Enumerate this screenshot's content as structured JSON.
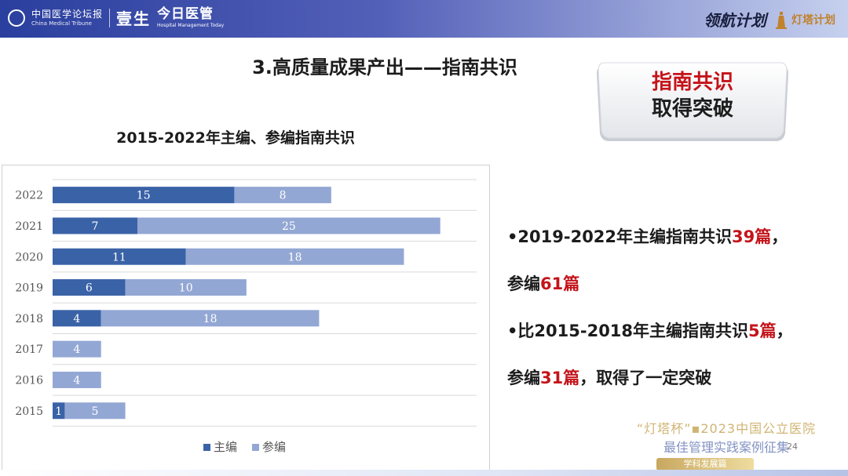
{
  "header": {
    "logo1_cn": "中国医学论坛报",
    "logo1_en": "China Medical Tribune",
    "logo2": "壹生",
    "logo3_cn": "今日医管",
    "logo3_en": "Hospital Management Today",
    "right_script": "领航计划",
    "right_lamp": "灯塔计划"
  },
  "title": "3.高质量成果产出——指南共识",
  "badge": {
    "line1": "指南共识",
    "line2": "取得突破"
  },
  "bullets": [
    {
      "p1": "•2019-2022年主编指南共识",
      "n1": "39篇",
      "p2": "，"
    },
    {
      "p1": "参编",
      "n1": "61篇",
      "p2": ""
    },
    {
      "p1": "•比2015-2018年主编指南共识",
      "n1": "5篇",
      "p2": "，"
    },
    {
      "p1": "参编",
      "n1": "31篇",
      "p2": "，取得了一定突破"
    }
  ],
  "footer": {
    "line1": "“灯塔杯”▪2023中国公立医院",
    "line2": "最佳管理实践案例征集",
    "chip": "学科发展篇",
    "page": "24"
  },
  "colors": {
    "zhubian": "#3a62a7",
    "canbian": "#93a7d4",
    "accent_red": "#c4141a"
  },
  "chart_data": {
    "type": "bar",
    "orientation": "horizontal",
    "stacked": true,
    "title": "2015-2022年主编、参编指南共识",
    "categories": [
      "2022",
      "2021",
      "2020",
      "2019",
      "2018",
      "2017",
      "2016",
      "2015"
    ],
    "series": [
      {
        "name": "主编",
        "values": [
          15,
          7,
          11,
          6,
          4,
          0,
          0,
          1
        ]
      },
      {
        "name": "参编",
        "values": [
          8,
          25,
          18,
          10,
          18,
          4,
          4,
          5
        ]
      }
    ],
    "xlim": [
      0,
      35
    ],
    "grid": true,
    "legend": "bottom"
  }
}
